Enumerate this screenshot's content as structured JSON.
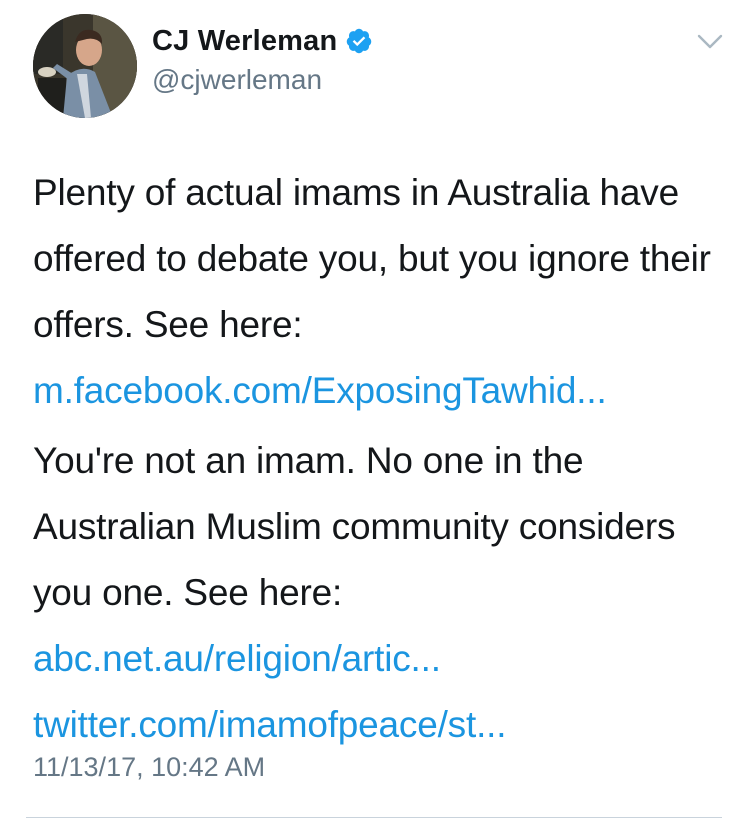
{
  "author": {
    "display_name": "CJ Werleman",
    "handle": "@cjwerleman",
    "verified": true,
    "avatar": "profile-photo-speaker-at-podium"
  },
  "header": {
    "menu_icon": "chevron-down-icon"
  },
  "tweet": {
    "paragraph_1": {
      "text": "Plenty of actual imams in Australia have offered to debate you, but you ignore their offers. See here:",
      "link": "m.facebook.com/ExposingTawhid..."
    },
    "paragraph_2": {
      "text": "You're not an imam. No one in the Australian Muslim community considers you one. See here:",
      "link_1": "abc.net.au/religion/artic...",
      "link_2": "twitter.com/imamofpeace/st..."
    },
    "timestamp": "11/13/17, 10:42 AM"
  },
  "colors": {
    "text": "#14171a",
    "secondary": "#657786",
    "link": "#1b95e0",
    "verified": "#1da1f2",
    "divider": "#c9d3dc"
  }
}
